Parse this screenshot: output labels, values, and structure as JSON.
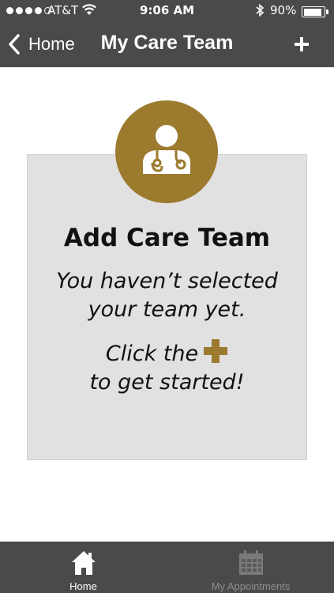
{
  "status_bar": {
    "carrier": "AT&T",
    "time": "9:06 AM",
    "battery_percent": "90%",
    "battery_level": 0.9,
    "signal_bars_filled": 4,
    "signal_bars_total": 5,
    "icons": [
      "wifi-icon",
      "bluetooth-icon",
      "battery-icon"
    ]
  },
  "nav": {
    "back_label": "Home",
    "title": "My Care Team",
    "add_icon": "plus-icon"
  },
  "card": {
    "icon": "doctor-icon",
    "title": "Add Care Team",
    "subtitle_line1": "You haven’t selected",
    "subtitle_line2": "your team yet.",
    "instruction_line1": "Click the",
    "instruction_icon": "plus-icon",
    "instruction_line2": "to get started!"
  },
  "tabs": [
    {
      "label": "Home",
      "icon": "home-icon",
      "active": true
    },
    {
      "label": "My Appointments",
      "icon": "calendar-icon",
      "active": false
    }
  ],
  "colors": {
    "header_bg": "#4a4a4a",
    "accent_gold": "#9c7a2e",
    "card_bg": "#e1e1e1",
    "tab_active": "#ffffff",
    "tab_inactive": "#8e8e8e"
  }
}
